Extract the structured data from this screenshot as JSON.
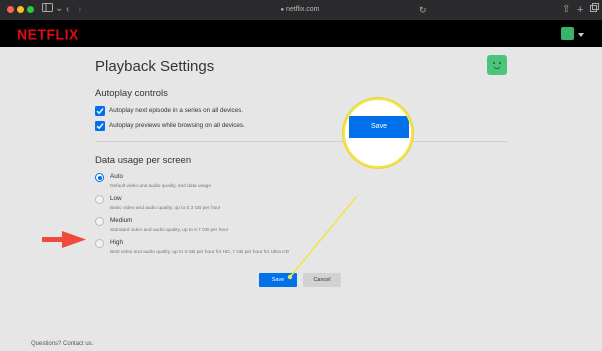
{
  "browser": {
    "url": "netflix.com",
    "colors": {
      "close": "#ff5f57",
      "minimize": "#febc2e",
      "maximize": "#28c840"
    },
    "icons": [
      "sidebar-icon",
      "back-icon",
      "forward-icon",
      "lock-icon",
      "reload-icon",
      "share-icon",
      "new-tab-icon",
      "tabs-icon"
    ]
  },
  "header": {
    "logo": "NETFLIX",
    "brand_color": "#e50914",
    "avatar_color": "#3ab36b"
  },
  "page": {
    "title": "Playback Settings",
    "avatar_color": "#4cc57a"
  },
  "autoplay": {
    "title": "Autoplay controls",
    "options": [
      {
        "label": "Autoplay next episode in a series on all devices.",
        "checked": true
      },
      {
        "label": "Autoplay previews while browsing on all devices.",
        "checked": true
      }
    ]
  },
  "data_usage": {
    "title": "Data usage per screen",
    "options": [
      {
        "label": "Auto",
        "description": "Default video and audio quality, and data usage",
        "selected": true
      },
      {
        "label": "Low",
        "description": "Basic video and audio quality, up to 0.3 GB per hour",
        "selected": false
      },
      {
        "label": "Medium",
        "description": "Standard video and audio quality, up to 0.7 GB per hour",
        "selected": false
      },
      {
        "label": "High",
        "description": "Best video and audio quality, up to 3 GB per hour for HD, 7 GB per hour for Ultra HD",
        "selected": false
      }
    ]
  },
  "buttons": {
    "save": "Save",
    "cancel": "Cancel"
  },
  "callout": {
    "label": "Save",
    "highlight_color": "#f2e44a",
    "arrow_color": "#f04a3a"
  },
  "footer": {
    "text": "Questions? Contact us."
  },
  "accent_color": "#0071eb"
}
